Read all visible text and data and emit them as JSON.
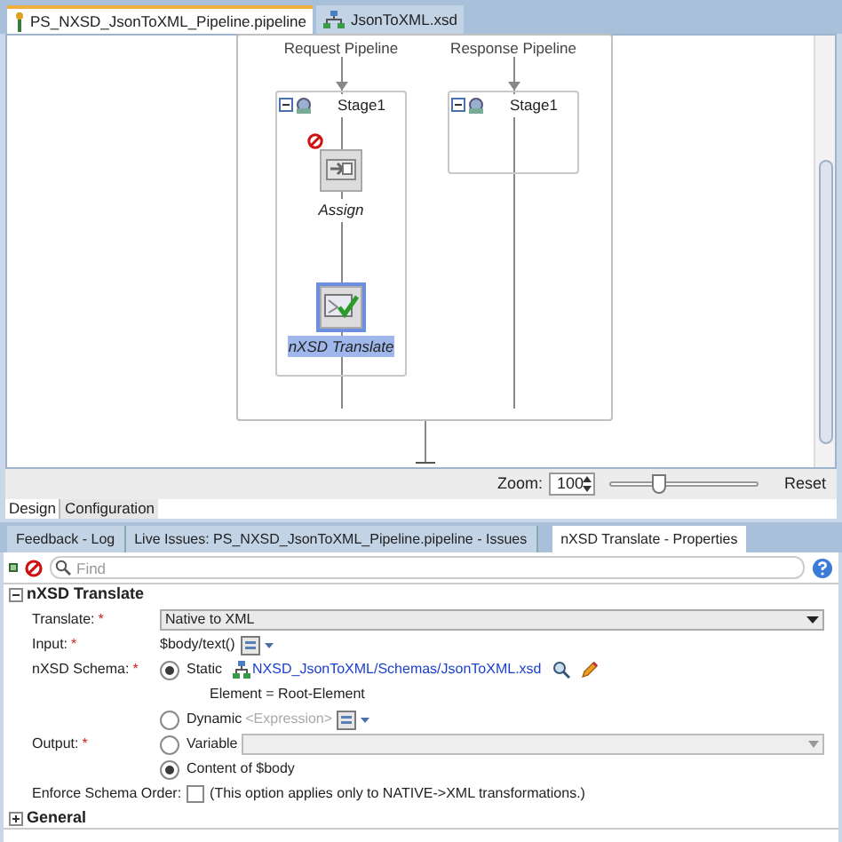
{
  "editor_tabs": [
    {
      "label": "PS_NXSD_JsonToXML_Pipeline.pipeline",
      "selected": true,
      "kind": "pipeline"
    },
    {
      "label": "JsonToXML.xsd",
      "selected": false,
      "kind": "schema"
    }
  ],
  "diagram": {
    "pipelines": [
      {
        "title": "Request Pipeline",
        "stage": {
          "title": "Stage1",
          "actions": [
            {
              "label": "Assign",
              "kind": "assign",
              "selected": false,
              "error": true
            },
            {
              "label": "nXSD Translate",
              "kind": "translate",
              "selected": true,
              "error": false
            }
          ]
        }
      },
      {
        "title": "Response Pipeline",
        "stage": {
          "title": "Stage1"
        }
      }
    ]
  },
  "zoom": {
    "label": "Zoom:",
    "value": "100",
    "level": 0.33,
    "reset": "Reset"
  },
  "view_tabs": [
    {
      "label": "Design",
      "selected": true
    },
    {
      "label": "Configuration",
      "selected": false
    }
  ],
  "panel_tabs": [
    {
      "label": "Feedback - Log",
      "selected": false
    },
    {
      "label": "Live Issues: PS_NXSD_JsonToXML_Pipeline.pipeline - Issues",
      "selected": false
    },
    {
      "label": "nXSD Translate - Properties",
      "selected": true
    }
  ],
  "find": {
    "placeholder": "Find"
  },
  "sections": [
    {
      "title": "nXSD Translate",
      "expanded": true
    },
    {
      "title": "General",
      "expanded": false
    }
  ],
  "properties": {
    "translate": {
      "label": "Translate:",
      "required": "*",
      "value": "Native to XML"
    },
    "input": {
      "label": "Input:",
      "required": "*",
      "value": "$body/text()"
    },
    "schema": {
      "label": "nXSD Schema:",
      "required": "*",
      "static": {
        "label": "Static",
        "selected": true
      },
      "path": "NXSD_JsonToXML/Schemas/JsonToXML.xsd",
      "element": "Element = Root-Element",
      "dynamic": {
        "label": "Dynamic",
        "selected": false
      },
      "expression_placeholder": "<Expression>"
    },
    "output": {
      "label": "Output:",
      "required": "*",
      "variable": {
        "label": "Variable",
        "selected": false
      },
      "content": {
        "label": "Content of $body",
        "selected": true
      }
    },
    "enforce": {
      "label": "Enforce Schema Order:",
      "checked": false,
      "note": "(This option applies only to NATIVE->XML transformations.)"
    }
  }
}
